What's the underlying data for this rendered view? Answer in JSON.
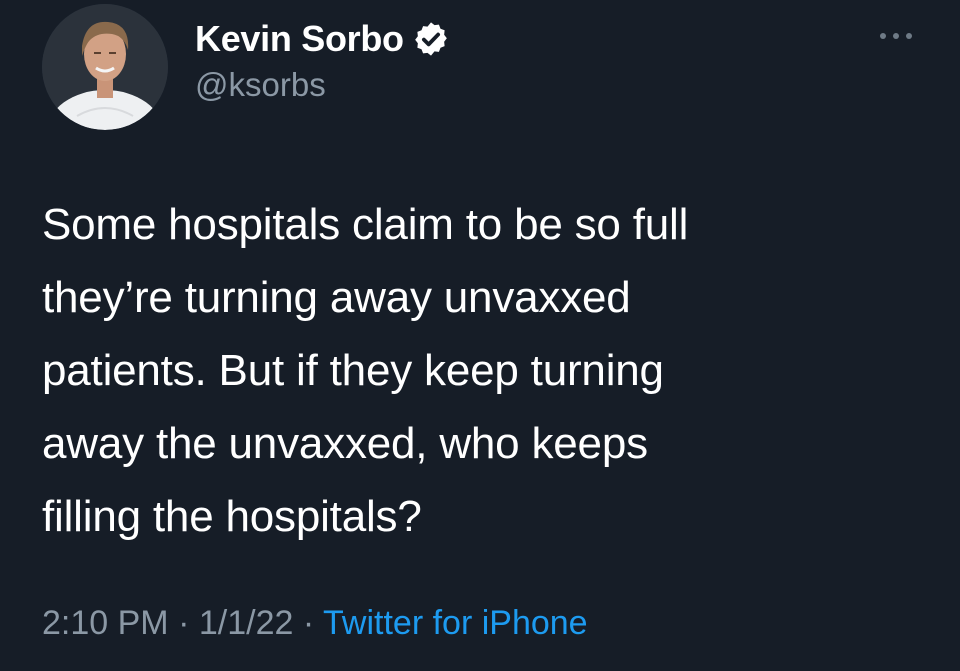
{
  "author": {
    "display_name": "Kevin Sorbo",
    "handle": "@ksorbs",
    "verified": true
  },
  "tweet": {
    "lines": [
      "Some hospitals claim to be so full",
      "they’re turning away unvaxxed",
      "patients. But if they keep turning",
      "away the unvaxxed, who keeps",
      "filling the hospitals?"
    ]
  },
  "meta": {
    "time": "2:10 PM",
    "separator": "·",
    "date": "1/1/22",
    "source": "Twitter for iPhone"
  },
  "colors": {
    "background": "#161d27",
    "text": "#ffffff",
    "secondary": "#8b98a5",
    "accent": "#1d9bf0"
  },
  "icons": {
    "verified": "verified-badge-icon",
    "more": "more-options-icon"
  }
}
